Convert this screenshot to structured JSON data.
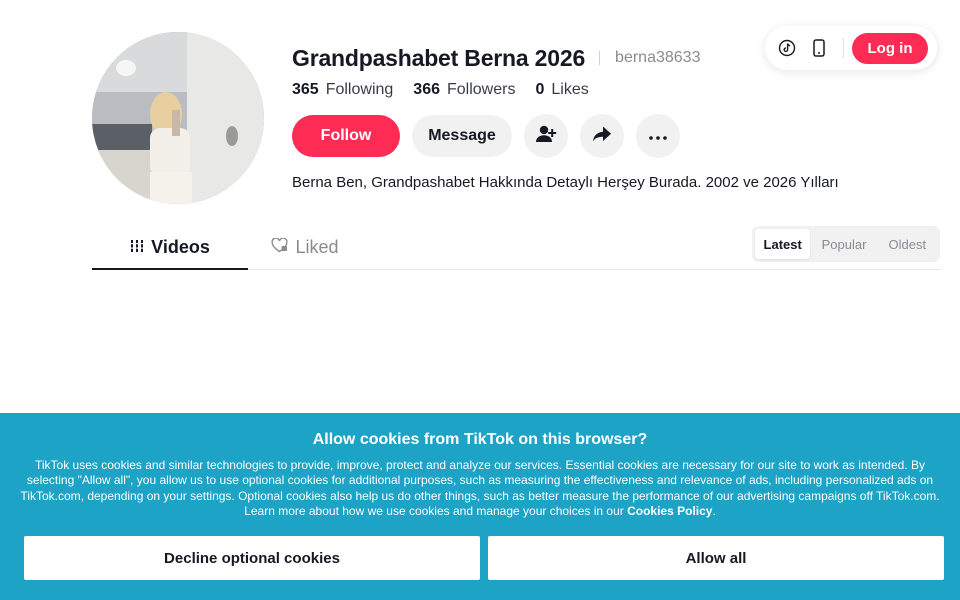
{
  "header": {
    "login_label": "Log in",
    "icons": [
      "tiktok-logo-icon",
      "mobile-icon"
    ]
  },
  "profile": {
    "display_name": "Grandpashabet Berna 2026",
    "username": "berna38633",
    "stats": {
      "following_count": "365",
      "following_label": "Following",
      "followers_count": "366",
      "followers_label": "Followers",
      "likes_count": "0",
      "likes_label": "Likes"
    },
    "follow_label": "Follow",
    "message_label": "Message",
    "bio": "Berna Ben, Grandpashabet Hakkında Detaylı Herşey Burada. 2002 ve 2026 Yılları"
  },
  "tabs": [
    {
      "label": "Videos",
      "active": true
    },
    {
      "label": "Liked",
      "active": false
    }
  ],
  "sort": {
    "options": [
      "Latest",
      "Popular",
      "Oldest"
    ],
    "selected": "Latest"
  },
  "cookie_banner": {
    "title": "Allow cookies from TikTok on this browser?",
    "body": "TikTok uses cookies and similar technologies to provide, improve, protect and analyze our services. Essential cookies are necessary for our site to work as intended. By selecting \"Allow all\", you allow us to use optional cookies for additional purposes, such as measuring the effectiveness and relevance of ads, including personalized ads on TikTok.com, depending on your settings. Optional cookies also help us do other things, such as better measure the performance of our advertising campaigns off TikTok.com. Learn more about how we use cookies and manage your choices in our",
    "policy_link": "Cookies Policy",
    "trailing": ".",
    "decline_label": "Decline optional cookies",
    "allow_label": "Allow all"
  },
  "colors": {
    "brand": "#fe2c55",
    "banner": "#1ca3c6"
  }
}
